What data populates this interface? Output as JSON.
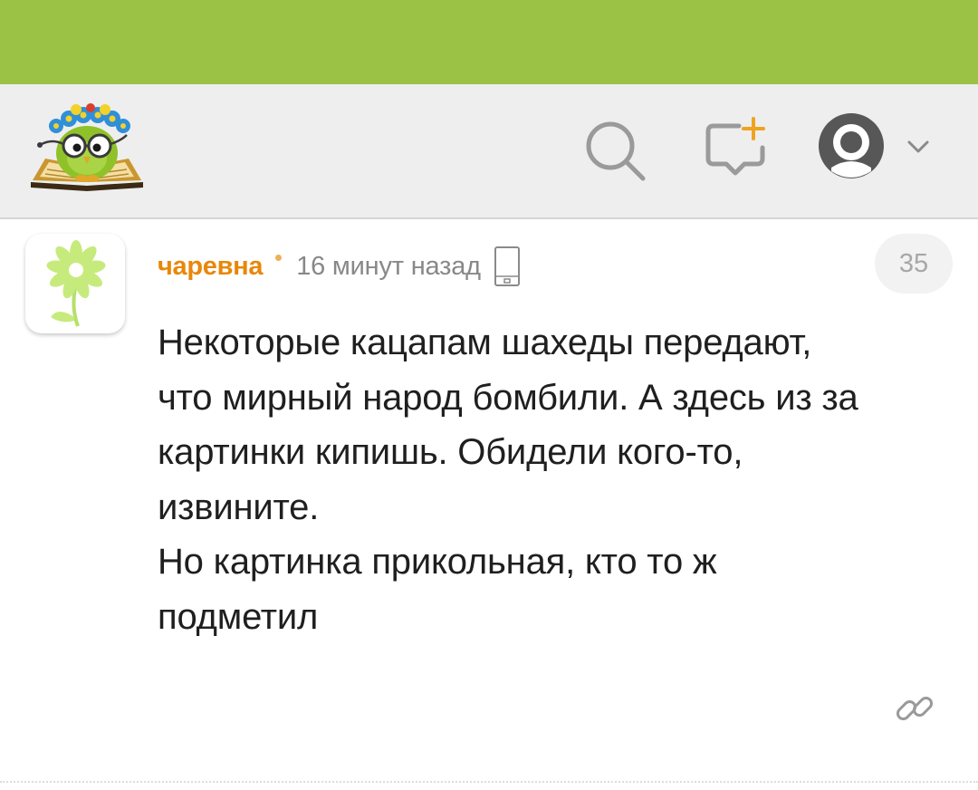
{
  "colors": {
    "status_bar": "#9bc145",
    "header_bg": "#eeeeee",
    "author": "#e8870a",
    "muted_text": "#888888",
    "icon_gray": "#9a9a9a"
  },
  "header": {
    "logo_icon": "owl-on-book-logo-icon",
    "search_icon": "search-icon",
    "new_post_icon": "new-post-icon",
    "account_icon": "user-avatar-icon",
    "dropdown_icon": "chevron-down-icon"
  },
  "comment": {
    "author": "чаревна",
    "time": "16 минут назад",
    "device_icon": "mobile-phone-icon",
    "rating": "35",
    "text_lines": [
      "Некоторые кацапам шахеды передают,",
      "что мирный народ бомбили. А здесь из за",
      "картинки кипишь. Обидели кого-то,",
      "извините.",
      "Но картинка прикольная, кто то ж",
      "подметил"
    ],
    "link_icon": "link-icon"
  }
}
